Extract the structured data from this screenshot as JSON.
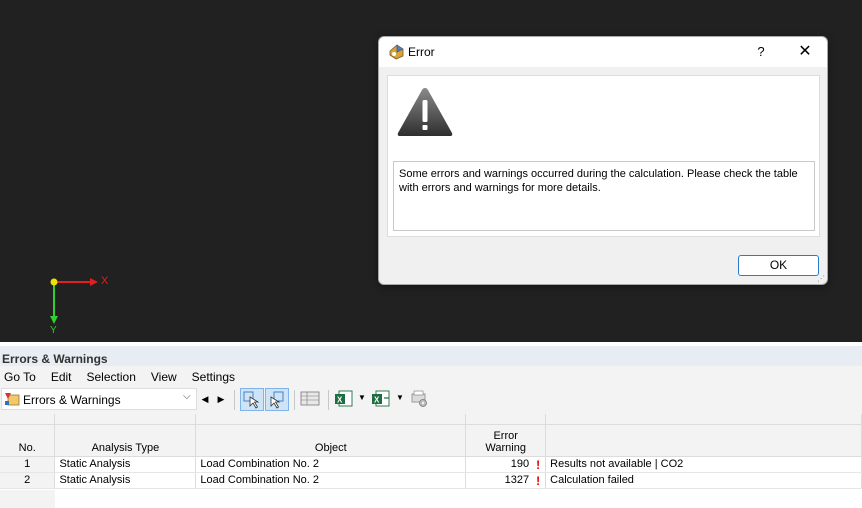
{
  "viewport": {
    "axis_x_label": "X",
    "axis_y_label": "Y"
  },
  "dialog": {
    "title": "Error",
    "help_label": "?",
    "close_label": "✕",
    "message": "Some errors and warnings occurred during the calculation. Please check the table with errors and warnings for more details.",
    "ok_label": "OK"
  },
  "panel": {
    "title": "Errors & Warnings",
    "menu": [
      "Go To",
      "Edit",
      "Selection",
      "View",
      "Settings"
    ],
    "dropdown_value": "Errors & Warnings",
    "columns": {
      "no": "No.",
      "analysis_type": "Analysis Type",
      "object": "Object",
      "code_line1": "Error",
      "code_line2": "Warning",
      "description": ""
    },
    "rows": [
      {
        "no": "1",
        "analysis_type": "Static Analysis",
        "object": "Load Combination No. 2",
        "code": "190",
        "description": "Results not available | CO2"
      },
      {
        "no": "2",
        "analysis_type": "Static Analysis",
        "object": "Load Combination No. 2",
        "code": "1327",
        "description": "Calculation failed"
      }
    ]
  },
  "colors": {
    "viewport_bg": "#212121",
    "x_axis": "#e02020",
    "y_axis": "#30d030",
    "origin": "#f0e000",
    "error_mark": "#e00000",
    "ok_border": "#2a7ad4"
  }
}
